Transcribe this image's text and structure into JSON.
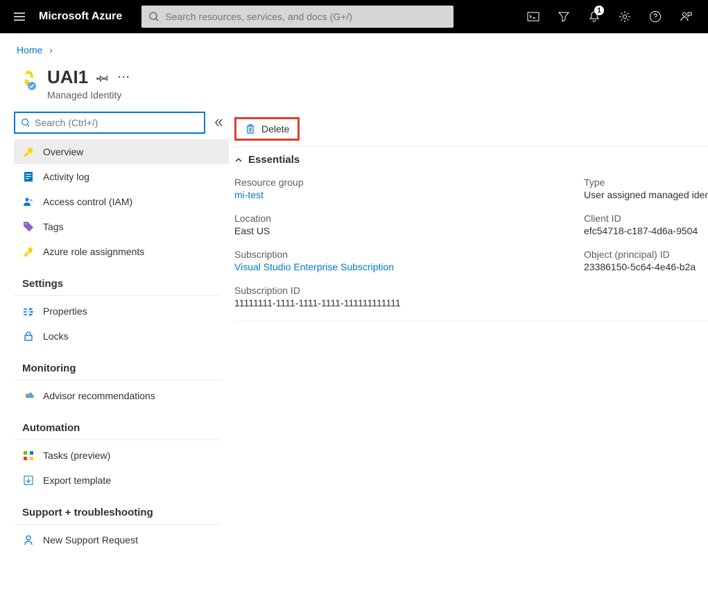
{
  "header": {
    "brand": "Microsoft Azure",
    "search_placeholder": "Search resources, services, and docs (G+/)",
    "notification_count": "1"
  },
  "breadcrumb": {
    "home": "Home"
  },
  "page": {
    "title": "UAI1",
    "subtitle": "Managed Identity"
  },
  "sidebar": {
    "search_placeholder": "Search (Ctrl+/)",
    "items_general": [
      {
        "label": "Overview"
      },
      {
        "label": "Activity log"
      },
      {
        "label": "Access control (IAM)"
      },
      {
        "label": "Tags"
      },
      {
        "label": "Azure role assignments"
      }
    ],
    "section_settings": "Settings",
    "items_settings": [
      {
        "label": "Properties"
      },
      {
        "label": "Locks"
      }
    ],
    "section_monitoring": "Monitoring",
    "items_monitoring": [
      {
        "label": "Advisor recommendations"
      }
    ],
    "section_automation": "Automation",
    "items_automation": [
      {
        "label": "Tasks (preview)"
      },
      {
        "label": "Export template"
      }
    ],
    "section_support": "Support + troubleshooting",
    "items_support": [
      {
        "label": "New Support Request"
      }
    ]
  },
  "toolbar": {
    "delete_label": "Delete"
  },
  "essentials": {
    "heading": "Essentials",
    "resource_group_label": "Resource group",
    "resource_group_value": "mi-test",
    "location_label": "Location",
    "location_value": "East US",
    "subscription_label": "Subscription",
    "subscription_value": "Visual Studio Enterprise Subscription",
    "subscription_id_label": "Subscription ID",
    "subscription_id_value": "11111111-1111-1111-1111-111111111111",
    "type_label": "Type",
    "type_value": "User assigned managed identity",
    "client_id_label": "Client ID",
    "client_id_value": "efc54718-c187-4d6a-9504",
    "object_id_label": "Object (principal) ID",
    "object_id_value": "23386150-5c64-4e46-b2a"
  }
}
